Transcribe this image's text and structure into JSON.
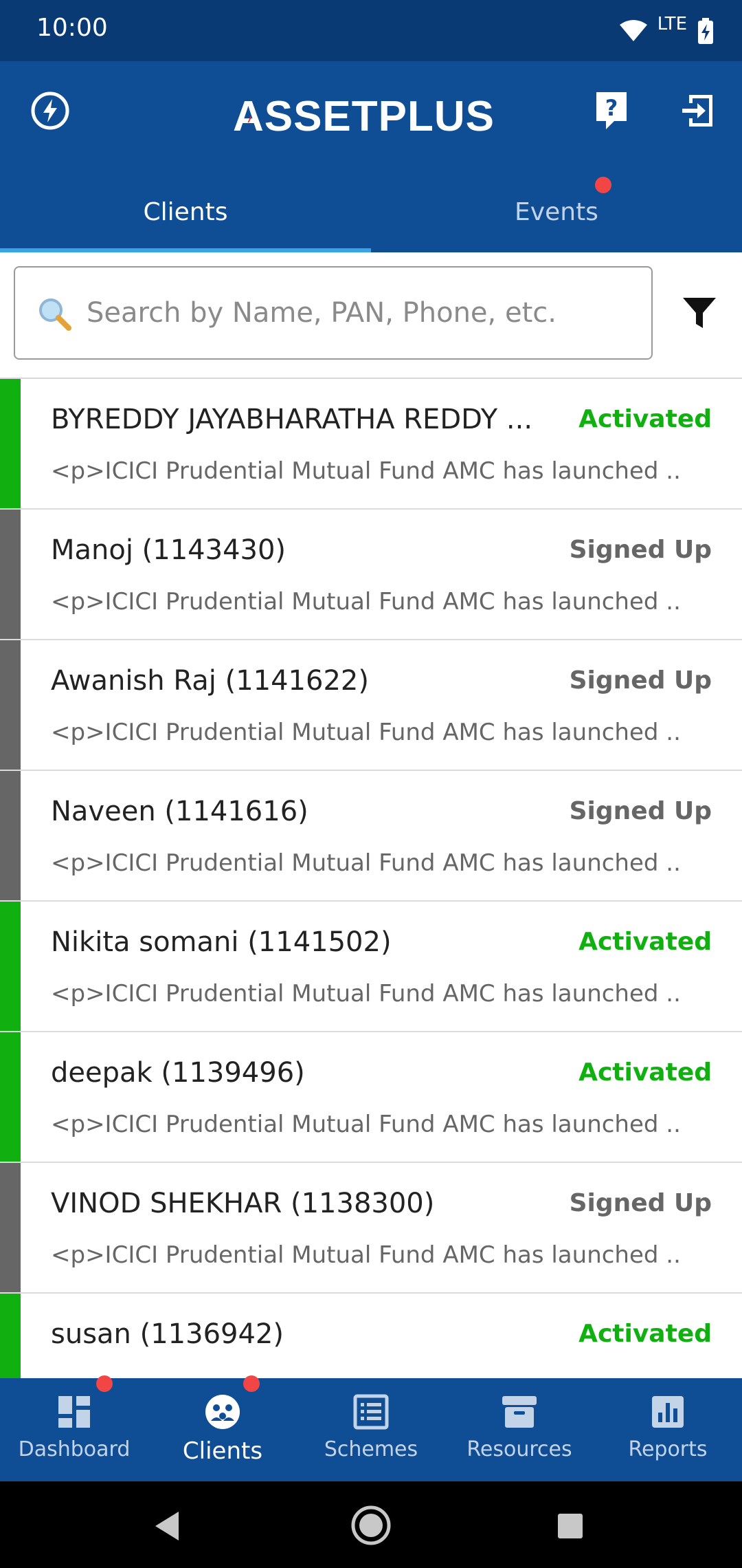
{
  "status_bar": {
    "time": "10:00",
    "network": "LTE"
  },
  "app": {
    "logo_text": "ASSETPLUS",
    "accent": "#e8252b"
  },
  "tabs": [
    {
      "label": "Clients",
      "active": true
    },
    {
      "label": "Events",
      "active": false,
      "has_notification": true
    }
  ],
  "search": {
    "placeholder": "Search by Name, PAN, Phone, etc."
  },
  "clients": [
    {
      "name": "BYREDDY JAYABHARATHA REDDY  ...",
      "status": "Activated",
      "message": "<p>ICICI Prudential Mutual Fund AMC has launched ..."
    },
    {
      "name": "Manoj  (1143430)",
      "status": "Signed Up",
      "message": "<p>ICICI Prudential Mutual Fund AMC has launched ..."
    },
    {
      "name": "Awanish Raj  (1141622)",
      "status": "Signed Up",
      "message": "<p>ICICI Prudential Mutual Fund AMC has launched ..."
    },
    {
      "name": "Naveen   (1141616)",
      "status": "Signed Up",
      "message": "<p>ICICI Prudential Mutual Fund AMC has launched ..."
    },
    {
      "name": "Nikita somani  (1141502)",
      "status": "Activated",
      "message": "<p>ICICI Prudential Mutual Fund AMC has launched ..."
    },
    {
      "name": "deepak  (1139496)",
      "status": "Activated",
      "message": "<p>ICICI Prudential Mutual Fund AMC has launched ..."
    },
    {
      "name": "VINOD  SHEKHAR  (1138300)",
      "status": "Signed Up",
      "message": "<p>ICICI Prudential Mutual Fund AMC has launched ..."
    },
    {
      "name": "susan  (1136942)",
      "status": "Activated",
      "message": ""
    }
  ],
  "status_colors": {
    "Activated": "#10b010",
    "Signed Up": "#666666"
  },
  "bottom_nav": [
    {
      "label": "Dashboard",
      "icon": "dashboard-icon",
      "has_notification": true
    },
    {
      "label": "Clients",
      "icon": "clients-icon",
      "active": true,
      "has_notification": true
    },
    {
      "label": "Schemes",
      "icon": "schemes-icon"
    },
    {
      "label": "Resources",
      "icon": "resources-icon"
    },
    {
      "label": "Reports",
      "icon": "reports-icon"
    }
  ]
}
